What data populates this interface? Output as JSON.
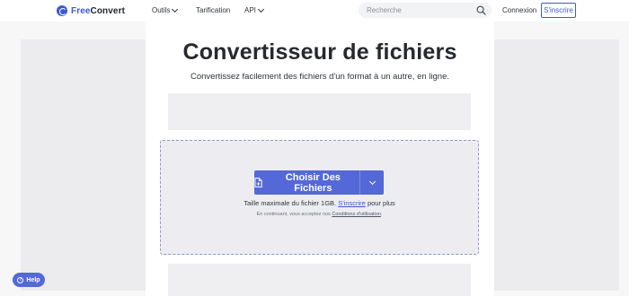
{
  "header": {
    "logo": {
      "free": "Free",
      "convert": "Convert"
    },
    "nav": [
      {
        "label": "Outils",
        "has_dropdown": true
      },
      {
        "label": "Tarification",
        "has_dropdown": false
      },
      {
        "label": "API",
        "has_dropdown": true
      }
    ],
    "search": {
      "placeholder": "Recherche",
      "value": ""
    },
    "login_label": "Connexion",
    "signup_label": "S'inscrire"
  },
  "main": {
    "title": "Convertisseur de fichiers",
    "subtitle": "Convertissez facilement des fichiers d'un format à un autre, en ligne.",
    "upload": {
      "choose_label": "Choisir Des Fichiers",
      "max_size_prefix": "Taille maximale du fichier 1GB.",
      "max_size_link": "S'inscrire",
      "max_size_suffix": "pour plus",
      "terms_prefix": "En continuant, vous acceptez nos",
      "terms_link": "Conditions d'utilisation",
      "terms_suffix": "."
    }
  },
  "help": {
    "label": "Help"
  },
  "colors": {
    "accent": "#3d58d1",
    "button": "#5468d8",
    "dropzone_border": "#8e98c4",
    "page_background": "#f7f7f8"
  },
  "icons": [
    "logo-icon",
    "chevron-down-icon",
    "search-icon",
    "file-icon",
    "help-icon"
  ]
}
